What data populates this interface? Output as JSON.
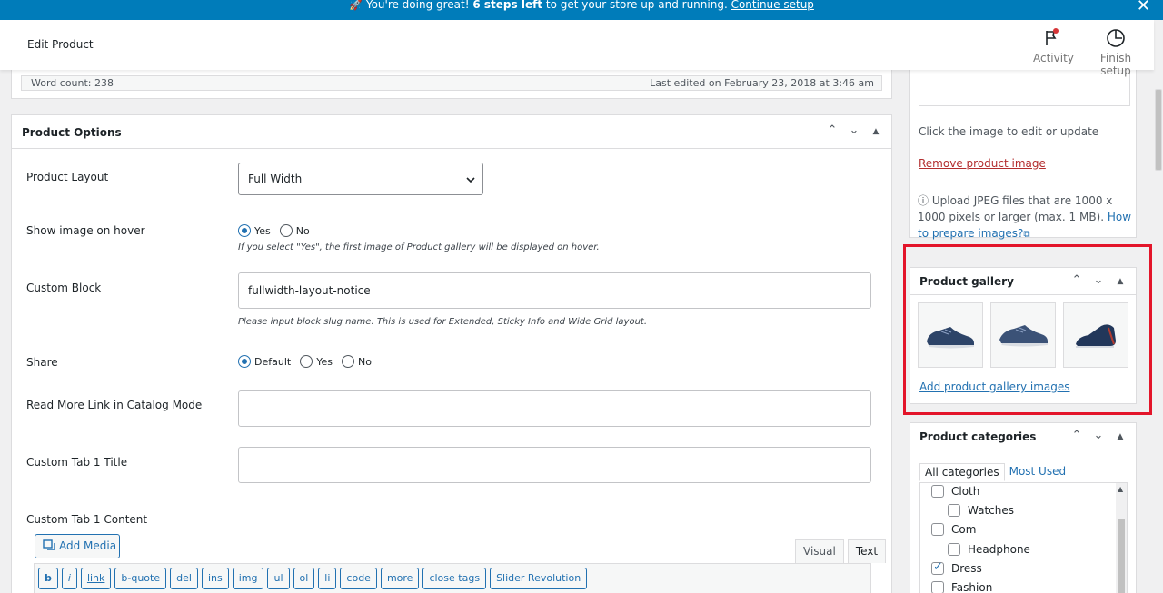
{
  "banner": {
    "emoji": "🚀",
    "text_before": " You're doing great! ",
    "text_bold": "6 steps left",
    "text_after": " to get your store up and running. ",
    "link": "Continue setup"
  },
  "header": {
    "title": "Edit Product",
    "activity_label": "Activity",
    "finish_setup_label": "Finish setup"
  },
  "editor_status": {
    "word_count": "Word count: 238",
    "last_edited": "Last edited on February 23, 2018 at 3:46 am"
  },
  "product_options": {
    "title": "Product Options",
    "product_layout": {
      "label": "Product Layout",
      "value": "Full Width"
    },
    "show_image_on_hover": {
      "label": "Show image on hover",
      "options": [
        "Yes",
        "No"
      ],
      "selected": "Yes",
      "help": "If you select \"Yes\", the first image of Product gallery will be displayed on hover."
    },
    "custom_block": {
      "label": "Custom Block",
      "value": "fullwidth-layout-notice",
      "help": "Please input block slug name. This is used for Extended, Sticky Info and Wide Grid layout."
    },
    "share": {
      "label": "Share",
      "options": [
        "Default",
        "Yes",
        "No"
      ],
      "selected": "Default"
    },
    "read_more_link": {
      "label": "Read More Link in Catalog Mode",
      "value": ""
    },
    "custom_tab_title": {
      "label": "Custom Tab 1 Title",
      "value": ""
    },
    "custom_tab_content": {
      "label": "Custom Tab 1 Content"
    },
    "add_media_label": "Add Media",
    "editor_tabs": {
      "visual": "Visual",
      "text": "Text"
    },
    "quicktags": [
      "b",
      "i",
      "link",
      "b-quote",
      "del",
      "ins",
      "img",
      "ul",
      "ol",
      "li",
      "code",
      "more",
      "close tags",
      "Slider Revolution"
    ]
  },
  "product_image": {
    "click_hint": "Click the image to edit or update",
    "remove_link": "Remove product image",
    "upload_note": "Upload JPEG files that are 1000 x 1000 pixels or larger (max. 1 MB).",
    "how_to_link": "How to prepare images?"
  },
  "product_gallery": {
    "title": "Product gallery",
    "add_link": "Add product gallery images"
  },
  "product_categories": {
    "title": "Product categories",
    "tabs": [
      "All categories",
      "Most Used"
    ],
    "items": [
      {
        "label": "Cloth",
        "checked": false
      },
      {
        "label": "Watches",
        "checked": false
      },
      {
        "label": "Com",
        "checked": false
      },
      {
        "label": "Headphone",
        "checked": false
      },
      {
        "label": "Dress",
        "checked": true
      },
      {
        "label": "Fashion",
        "checked": false
      }
    ]
  },
  "colors": {
    "accent": "#2271b1",
    "banner": "#007cba",
    "highlight": "#e3152a"
  }
}
